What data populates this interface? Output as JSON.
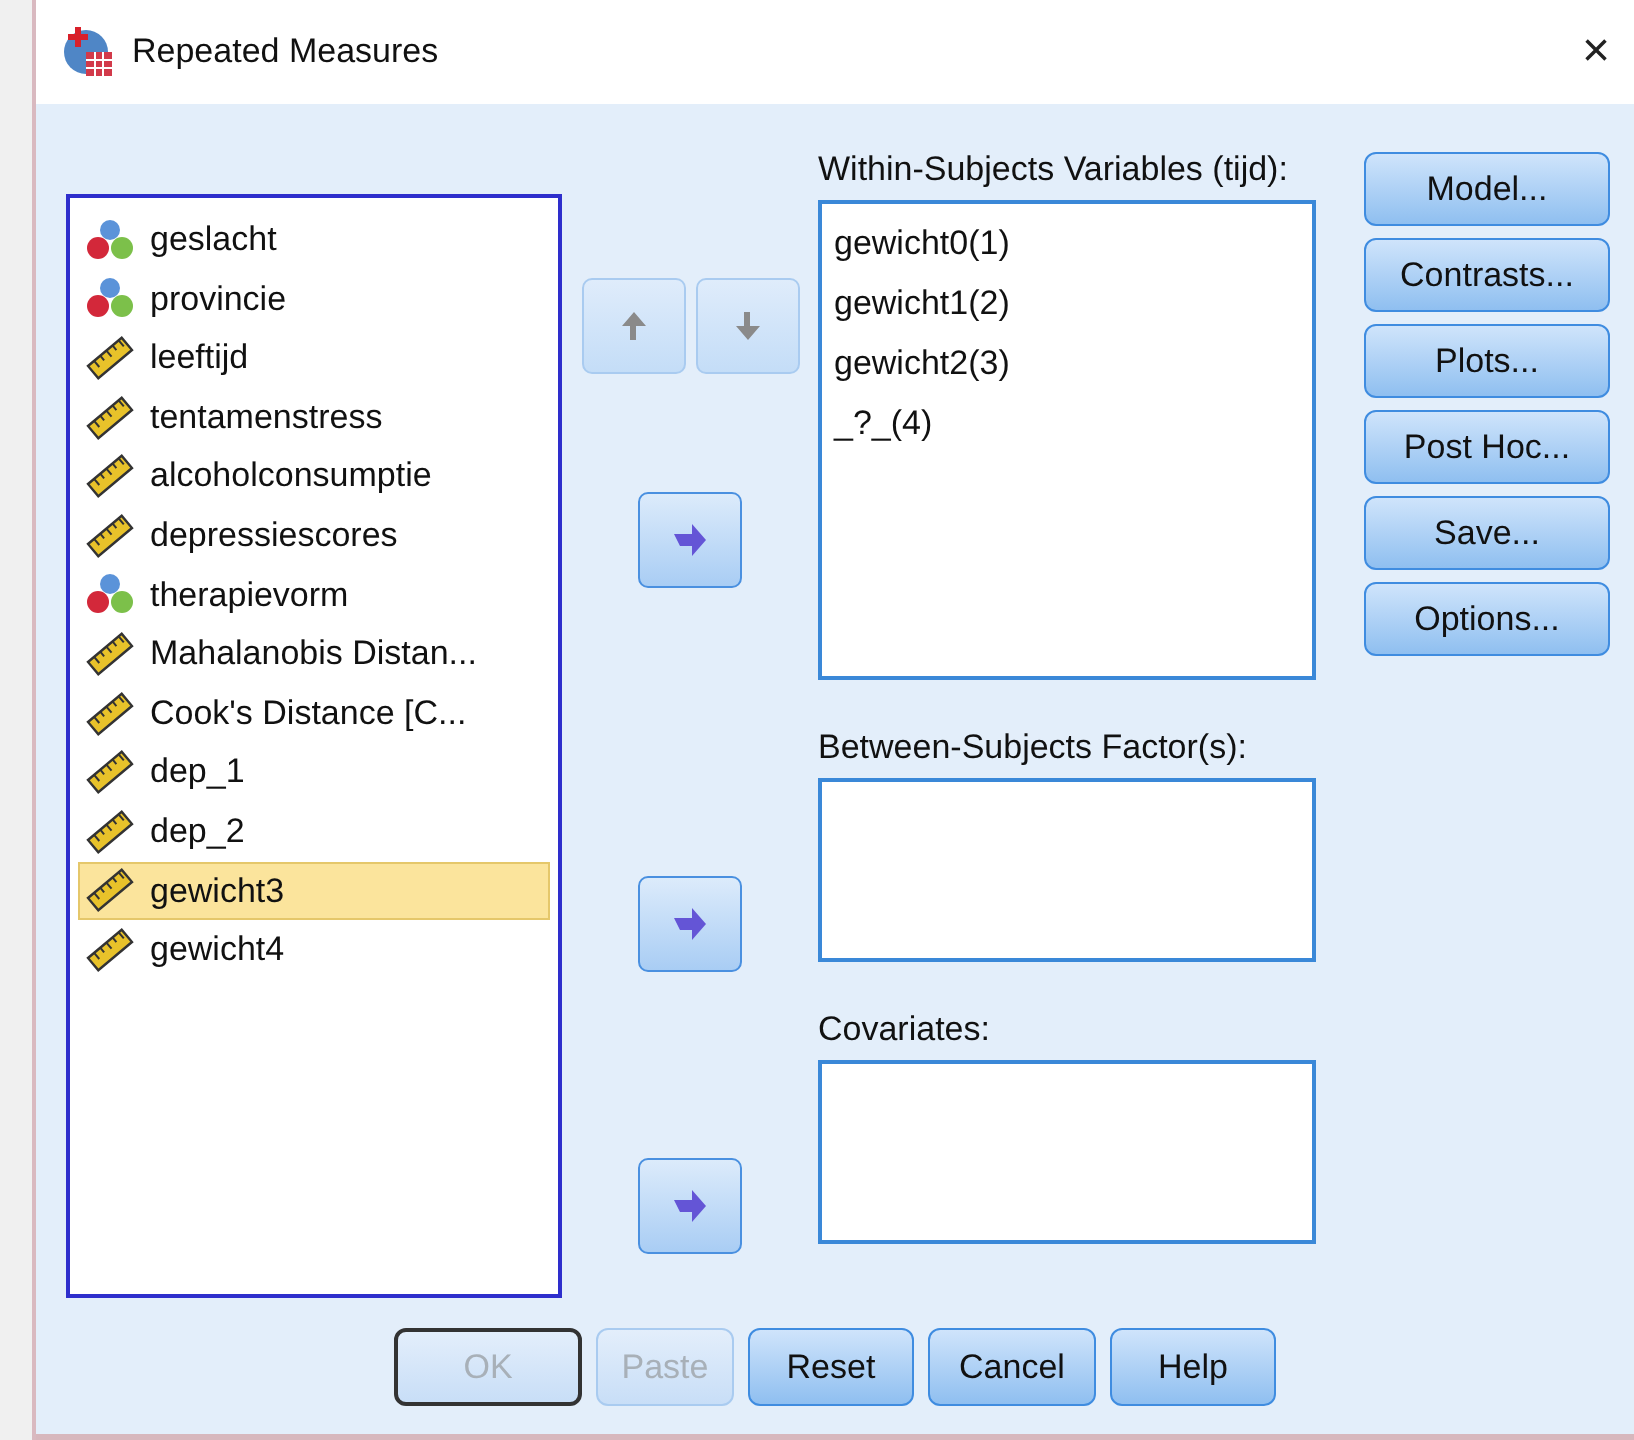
{
  "window": {
    "title": "Repeated Measures",
    "close": "×"
  },
  "variables": [
    {
      "name": "geslacht",
      "kind": "nominal",
      "selected": false
    },
    {
      "name": "provincie",
      "kind": "nominal",
      "selected": false
    },
    {
      "name": "leeftijd",
      "kind": "scale",
      "selected": false
    },
    {
      "name": "tentamenstress",
      "kind": "scale",
      "selected": false
    },
    {
      "name": "alcoholconsumptie",
      "kind": "scale",
      "selected": false
    },
    {
      "name": "depressiescores",
      "kind": "scale",
      "selected": false
    },
    {
      "name": "therapievorm",
      "kind": "nominal",
      "selected": false
    },
    {
      "name": "Mahalanobis Distan...",
      "kind": "scale",
      "selected": false
    },
    {
      "name": "Cook's Distance [C...",
      "kind": "scale",
      "selected": false
    },
    {
      "name": "dep_1",
      "kind": "scale",
      "selected": false
    },
    {
      "name": "dep_2",
      "kind": "scale",
      "selected": false
    },
    {
      "name": "gewicht3",
      "kind": "scale",
      "selected": true
    },
    {
      "name": "gewicht4",
      "kind": "scale",
      "selected": false
    }
  ],
  "within": {
    "label": "Within-Subjects Variables (tijd):",
    "items": [
      "gewicht0(1)",
      "gewicht1(2)",
      "gewicht2(3)",
      "_?_(4)"
    ]
  },
  "between": {
    "label": "Between-Subjects Factor(s):"
  },
  "covariates": {
    "label": "Covariates:"
  },
  "side_buttons": [
    "Model...",
    "Contrasts...",
    "Plots...",
    "Post Hoc...",
    "Save...",
    "Options..."
  ],
  "bottom_buttons": [
    {
      "label": "OK",
      "disabled": true,
      "default": true
    },
    {
      "label": "Paste",
      "disabled": true,
      "default": false
    },
    {
      "label": "Reset",
      "disabled": false,
      "default": false
    },
    {
      "label": "Cancel",
      "disabled": false,
      "default": false
    },
    {
      "label": "Help",
      "disabled": false,
      "default": false
    }
  ]
}
